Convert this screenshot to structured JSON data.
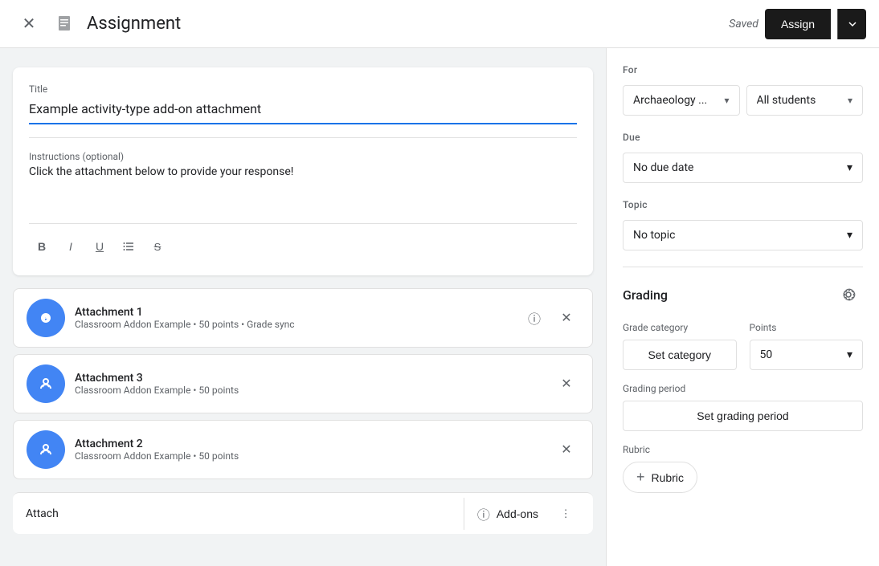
{
  "header": {
    "title": "Assignment",
    "saved_text": "Saved",
    "assign_label": "Assign"
  },
  "left": {
    "title_label": "Title",
    "title_value": "Example activity-type add-on attachment",
    "instructions_label": "Instructions (optional)",
    "instructions_text": "Click the attachment below to provide your response!",
    "formatting": {
      "bold": "B",
      "italic": "I",
      "underline": "U"
    },
    "attachments": [
      {
        "title": "Attachment 1",
        "subtitle": "Classroom Addon Example • 50 points • Grade sync"
      },
      {
        "title": "Attachment 3",
        "subtitle": "Classroom Addon Example • 50 points"
      },
      {
        "title": "Attachment 2",
        "subtitle": "Classroom Addon Example • 50 points"
      }
    ],
    "attach_label": "Attach",
    "addons_label": "Add-ons"
  },
  "right": {
    "for_label": "For",
    "class_value": "Archaeology ...",
    "students_value": "All students",
    "due_label": "Due",
    "due_value": "No due date",
    "topic_label": "Topic",
    "topic_value": "No topic",
    "grading_title": "Grading",
    "grade_category_label": "Grade category",
    "points_label": "Points",
    "set_category_label": "Set category",
    "points_value": "50",
    "grading_period_label": "Grading period",
    "set_grading_period_label": "Set grading period",
    "rubric_label": "Rubric",
    "add_rubric_label": "Rubric"
  }
}
